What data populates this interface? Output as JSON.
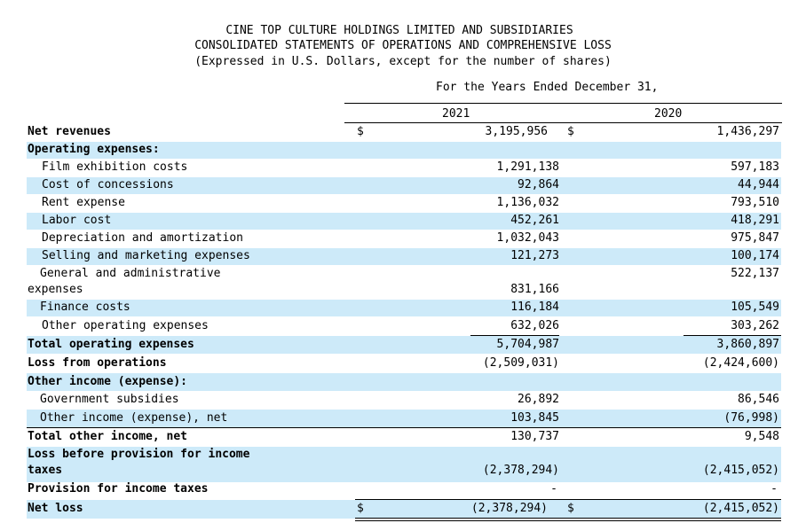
{
  "header": {
    "line1": "CINE TOP CULTURE HOLDINGS LIMITED AND SUBSIDIARIES",
    "line2": "CONSOLIDATED STATEMENTS OF OPERATIONS AND COMPREHENSIVE LOSS",
    "line3": "(Expressed in U.S. Dollars, except for the number of shares)",
    "period": "For the Years Ended December 31,",
    "year1": "2021",
    "year2": "2020"
  },
  "rows": [
    {
      "label": "Net revenues",
      "v2021": "3,195,956",
      "v2020": "1,436,297",
      "dollar1": "$",
      "dollar2": "$"
    },
    {
      "label": "Operating expenses:"
    },
    {
      "label": "Film exhibition costs",
      "v2021": "1,291,138",
      "v2020": "597,183"
    },
    {
      "label": "Cost of concessions",
      "v2021": "92,864",
      "v2020": "44,944"
    },
    {
      "label": "Rent expense",
      "v2021": "1,136,032",
      "v2020": "793,510"
    },
    {
      "label": "Labor cost",
      "v2021": "452,261",
      "v2020": "418,291"
    },
    {
      "label": "Depreciation and amortization",
      "v2021": "1,032,043",
      "v2020": "975,847"
    },
    {
      "label": "Selling and marketing expenses",
      "v2021": "121,273",
      "v2020": "100,174"
    },
    {
      "label1": "General and administrative",
      "label2": "expenses",
      "v2021": "831,166",
      "v2020": "522,137"
    },
    {
      "label": "Finance costs",
      "v2021": "116,184",
      "v2020": "105,549"
    },
    {
      "label": "Other operating expenses",
      "v2021": "632,026",
      "v2020": "303,262"
    },
    {
      "label": "Total operating expenses",
      "v2021": "5,704,987",
      "v2020": "3,860,897"
    },
    {
      "label": "Loss from operations",
      "v2021": "(2,509,031)",
      "v2020": "(2,424,600)"
    },
    {
      "label": "Other income (expense):"
    },
    {
      "label": "Government subsidies",
      "v2021": "26,892",
      "v2020": "86,546"
    },
    {
      "label": "Other income (expense), net",
      "v2021": "103,845",
      "v2020": "(76,998)"
    },
    {
      "label": "Total other income, net",
      "v2021": "130,737",
      "v2020": "9,548"
    },
    {
      "label1": "Loss before provision for income",
      "label2": "taxes",
      "v2021": "(2,378,294)",
      "v2020": "(2,415,052)"
    },
    {
      "label": "Provision for income taxes",
      "v2021": "-",
      "v2020": "-"
    },
    {
      "label": "Net loss",
      "v2021": "(2,378,294)",
      "v2020": "(2,415,052)",
      "dollar1": "$",
      "dollar2": "$"
    }
  ]
}
